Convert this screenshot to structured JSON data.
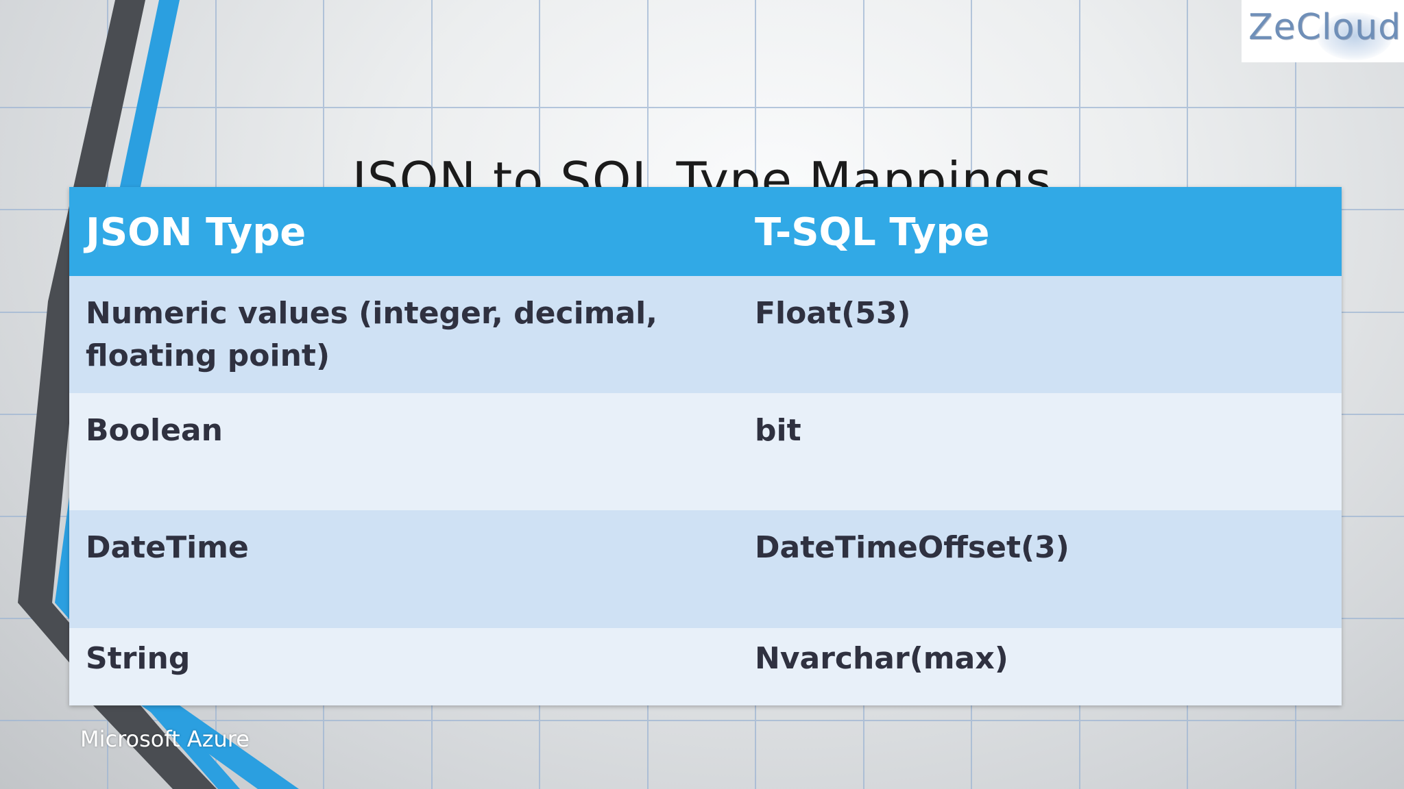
{
  "slide": {
    "title": "JSON to SQL Type Mappings",
    "footer": "Microsoft Azure",
    "logo_text": "ZeCloud"
  },
  "table": {
    "headers": [
      "JSON Type",
      "T-SQL Type"
    ],
    "rows": [
      [
        "Numeric values (integer, decimal, floating point)",
        "Float(53)"
      ],
      [
        "Boolean",
        "bit"
      ],
      [
        "DateTime",
        "DateTimeOffset(3)"
      ],
      [
        "String",
        "Nvarchar(max)"
      ]
    ]
  },
  "colors": {
    "header_bg": "#31a9e6",
    "row_dark": "#cfe1f4",
    "row_light": "#e8f0f9",
    "accent_blue": "#2b9fe0",
    "accent_gray": "#4a4d52"
  }
}
